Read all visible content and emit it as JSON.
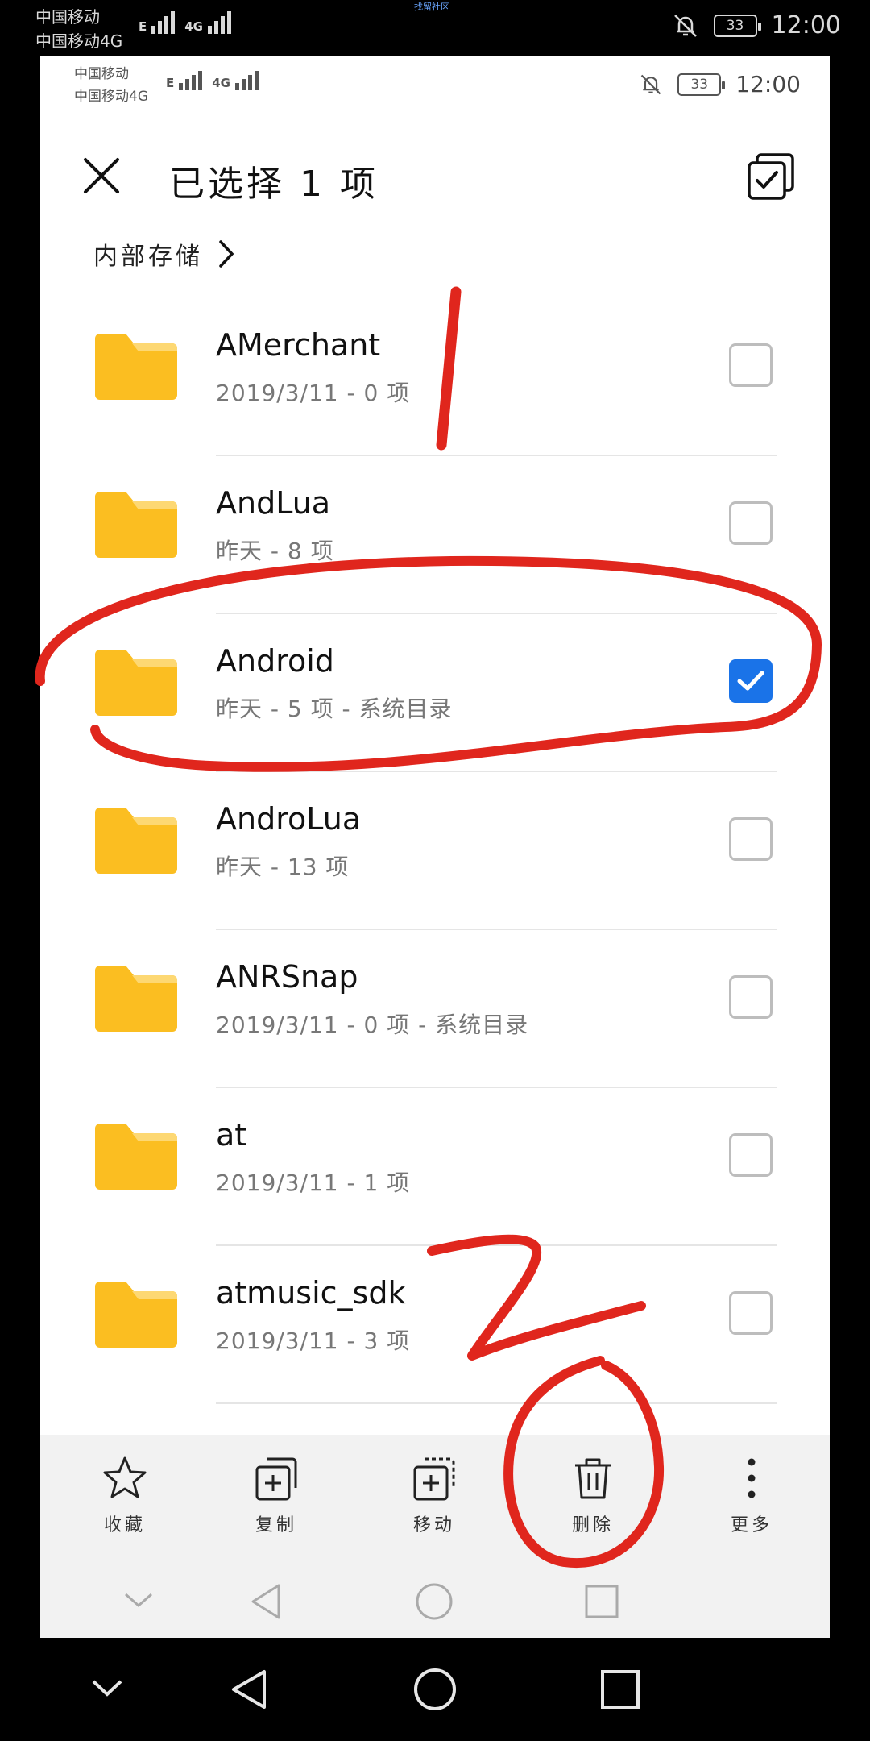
{
  "outer_status": {
    "carrier_1": "中国移动",
    "carrier_2": "中国移动4G",
    "net_e": "E",
    "net_4g": "4G",
    "battery": "33",
    "time": "12:00",
    "overlay_link": "找留社区"
  },
  "inner_status": {
    "carrier_1": "中国移动",
    "carrier_2": "中国移动4G",
    "net_e": "E",
    "net_4g": "4G",
    "battery": "33",
    "time": "12:00"
  },
  "header": {
    "title": "已选择 1 项",
    "close_icon": "close-icon",
    "select_all_icon": "select-all-icon"
  },
  "breadcrumb": {
    "label": "内部存储"
  },
  "folders": [
    {
      "name": "AMerchant",
      "meta": "2019/3/11 - 0 项",
      "checked": false
    },
    {
      "name": "AndLua",
      "meta": "昨天 - 8 项",
      "checked": false
    },
    {
      "name": "Android",
      "meta": "昨天 - 5 项 - 系统目录",
      "checked": true
    },
    {
      "name": "AndroLua",
      "meta": "昨天 - 13 项",
      "checked": false
    },
    {
      "name": "ANRSnap",
      "meta": "2019/3/11 - 0 项 - 系统目录",
      "checked": false
    },
    {
      "name": "at",
      "meta": "2019/3/11 - 1 项",
      "checked": false
    },
    {
      "name": "atmusic_sdk",
      "meta": "2019/3/11 - 3 项",
      "checked": false
    }
  ],
  "toolbar": {
    "favorite": "收藏",
    "copy": "复制",
    "move": "移动",
    "delete": "删除",
    "more": "更多"
  },
  "annotations": {
    "mark_1": "1",
    "mark_2": "2",
    "color": "#e0261d"
  },
  "colors": {
    "folder": "#FBBE21",
    "folder_tab": "#FDD873",
    "checkbox_on": "#1a73e8"
  }
}
